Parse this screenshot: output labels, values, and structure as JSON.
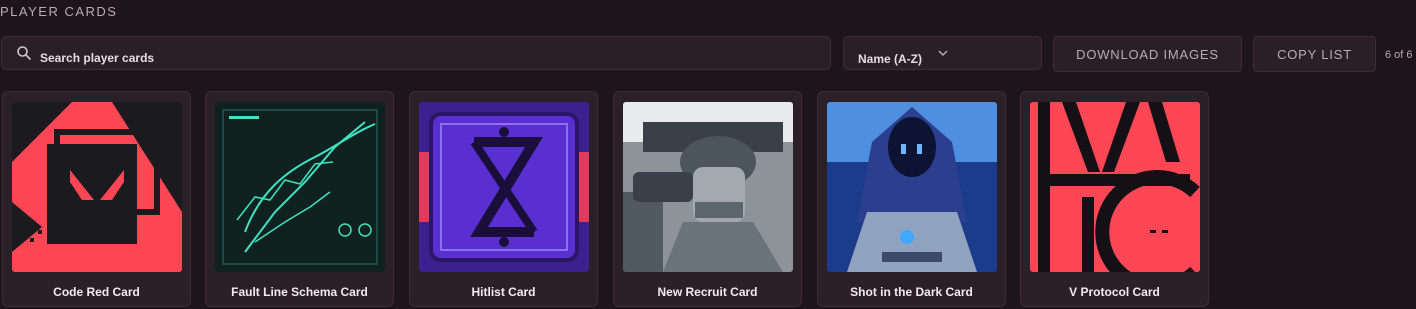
{
  "section_title": "PLAYER CARDS",
  "search": {
    "placeholder": "Search player cards"
  },
  "sort": {
    "selected": "Name (A-Z)"
  },
  "buttons": {
    "download": "DOWNLOAD IMAGES",
    "copy": "COPY LIST"
  },
  "count_text": "6 of 6",
  "cards": [
    {
      "name": "Code Red Card"
    },
    {
      "name": "Fault Line Schema Card"
    },
    {
      "name": "Hitlist Card"
    },
    {
      "name": "New Recruit Card"
    },
    {
      "name": "Shot in the Dark Card"
    },
    {
      "name": "V Protocol Card"
    }
  ],
  "colors": {
    "background": "#1e141b",
    "panel": "#2a1f27",
    "accent_red": "#ff4655"
  }
}
